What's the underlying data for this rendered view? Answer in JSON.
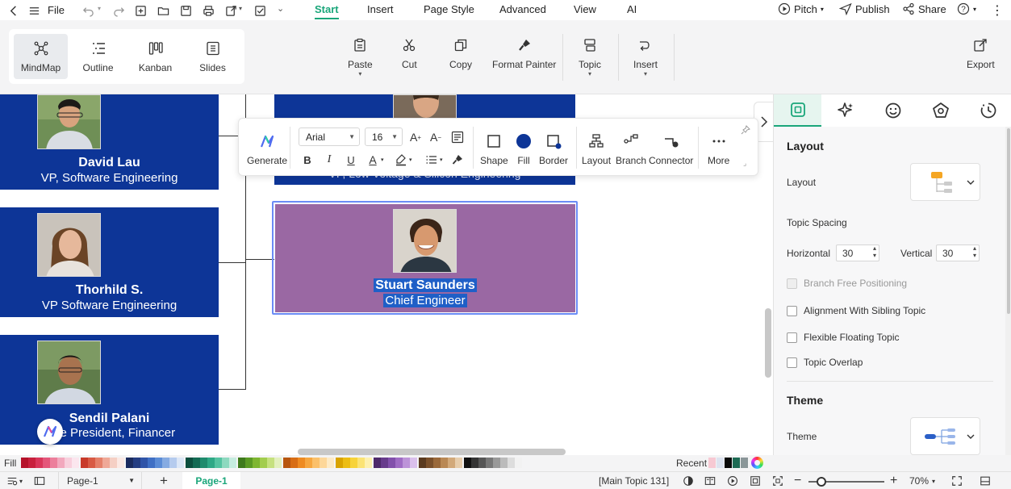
{
  "menu": {
    "file": "File",
    "tabs": [
      "Start",
      "Insert",
      "Page Style",
      "Advanced",
      "View",
      "AI"
    ],
    "right": {
      "pitch": "Pitch",
      "publish": "Publish",
      "share": "Share"
    }
  },
  "ribbon": {
    "views": [
      "MindMap",
      "Outline",
      "Kanban",
      "Slides"
    ],
    "paste": "Paste",
    "cut": "Cut",
    "copy": "Copy",
    "format_painter": "Format Painter",
    "topic": "Topic",
    "insert": "Insert",
    "export": "Export"
  },
  "canvas": {
    "cards": [
      {
        "name": "David Lau",
        "title": "VP, Software Engineering"
      },
      {
        "name": "Thorhild S.",
        "title": "VP Software Engineering"
      },
      {
        "name": "Sendil Palani",
        "title": "Vice President, Financer"
      }
    ],
    "selected_card": {
      "name": "Stuart Saunders",
      "title": "Chief Engineer"
    },
    "hidden_card_title": "VP, Low Voltage & Silicon Engineering"
  },
  "floatbar": {
    "generate": "Generate",
    "font": "Arial",
    "size": "16",
    "shape": "Shape",
    "fill": "Fill",
    "border": "Border",
    "layout": "Layout",
    "branch": "Branch",
    "connector": "Connector",
    "more": "More",
    "fill_color": "#0d3597"
  },
  "panel": {
    "layout_header": "Layout",
    "layout_label": "Layout",
    "topic_spacing": "Topic Spacing",
    "horizontal_label": "Horizontal",
    "horizontal_value": "30",
    "vertical_label": "Vertical",
    "vertical_value": "30",
    "options": [
      "Branch Free Positioning",
      "Alignment With Sibling Topic",
      "Flexible Floating Topic",
      "Topic Overlap"
    ],
    "theme_header": "Theme",
    "theme_label": "Theme"
  },
  "colorbar": {
    "fill_label": "Fill",
    "recent_label": "Recent"
  },
  "status": {
    "page_select": "Page-1",
    "page_tab": "Page-1",
    "selection": "[Main Topic 131]",
    "zoom": "70%"
  },
  "colors": {
    "accent": "#1aa67a",
    "card_blue": "#0d3597",
    "selected_card": "#9a68a3"
  }
}
